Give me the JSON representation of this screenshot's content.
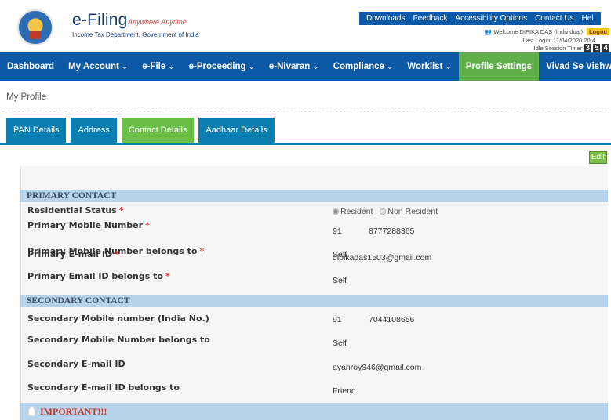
{
  "header": {
    "logo_title": "e-Filing",
    "logo_tagline": "Anywhere Anytime",
    "logo_subtitle": "Income Tax Department, Government of India",
    "top_links": [
      "Downloads",
      "Feedback",
      "Accessibility Options",
      "Contact Us",
      "Hel"
    ],
    "welcome_text": "Welcome DIPIKA DAS (Individual)",
    "logout_label": "Logou",
    "last_login": "Last Login: 11/04/2020 20:4",
    "session_timer_label": "Idle Session Timer",
    "session_timer_digits": [
      "3",
      "5",
      "4"
    ]
  },
  "nav": {
    "items": [
      {
        "label": "Dashboard",
        "chevron": ""
      },
      {
        "label": "My Account",
        "chevron": "⌄"
      },
      {
        "label": "e-File",
        "chevron": "⌄"
      },
      {
        "label": "e-Proceeding",
        "chevron": "⌄"
      },
      {
        "label": "e-Nivaran",
        "chevron": "⌄"
      },
      {
        "label": "Compliance",
        "chevron": "⌄"
      },
      {
        "label": "Worklist",
        "chevron": "⌄"
      },
      {
        "label": "Profile Settings",
        "chevron": ""
      },
      {
        "label": "Vivad Se Vishwas",
        "chevron": "⌄"
      }
    ],
    "active_index": 7
  },
  "breadcrumb": "My Profile",
  "tabs": {
    "items": [
      "PAN Details",
      "Address",
      "Contact Details",
      "Aadhaar Details"
    ],
    "active_index": 2
  },
  "edit_label": "Edit",
  "primary": {
    "title": "PRIMARY CONTACT",
    "residential_status_label": "Residential Status",
    "radio_resident": "Resident",
    "radio_non_resident": "Non Resident",
    "mobile_label": "Primary Mobile Number",
    "mobile_cc": "91",
    "mobile_value": "8777288365",
    "mobile_belongs_label": "Primary Mobile Number belongs to",
    "mobile_belongs_value": "Self",
    "email_label": "Primary E-mail ID",
    "email_value": "dipikadas1503@gmail.com",
    "email_belongs_label": "Primary Email ID belongs to",
    "email_belongs_value": "Self"
  },
  "secondary": {
    "title": "SECONDARY CONTACT",
    "mobile_label": "Secondary Mobile number (India No.)",
    "mobile_cc": "91",
    "mobile_value": "7044108656",
    "mobile_belongs_label": "Secondary Mobile Number belongs to",
    "mobile_belongs_value": "Self",
    "email_label": "Secondary E-mail ID",
    "email_value": "ayanroy946@gmail.com",
    "email_belongs_label": "Secondary E-mail ID belongs to",
    "email_belongs_value": "Friend"
  },
  "important_label": "IMPORTANT!!!",
  "required_marker": "*",
  "colors": {
    "nav_blue": "#0c5aa6",
    "tab_blue": "#0c7fb0",
    "active_green": "#6cc049",
    "section_blue": "#b7d3ea",
    "logout_yellow": "#f5c518"
  }
}
